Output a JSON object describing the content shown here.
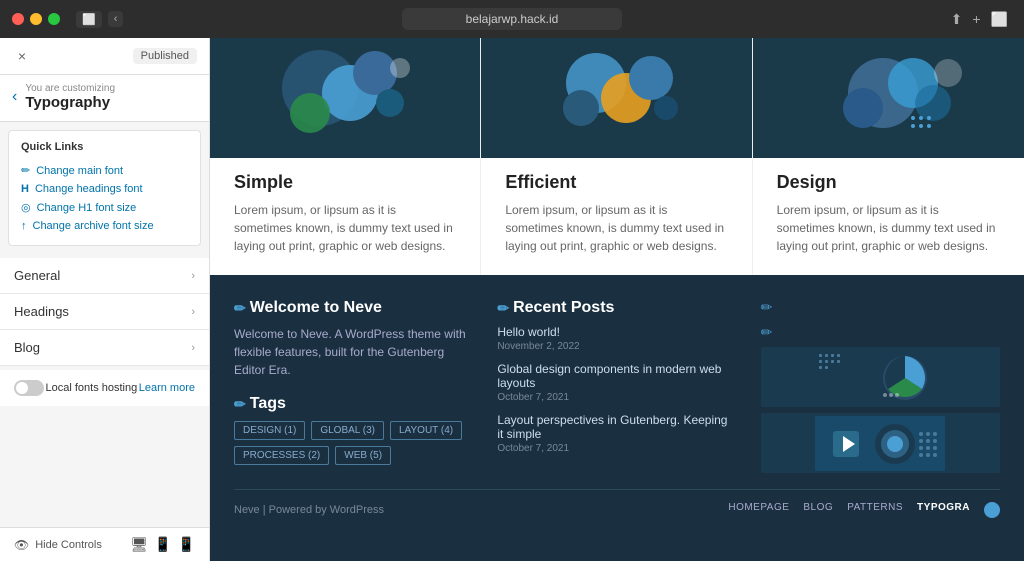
{
  "window": {
    "url": "belajarwp.hack.id",
    "title": "belajarwp.hack.id"
  },
  "customizer": {
    "close_label": "×",
    "published_label": "Published",
    "back_arrow": "‹",
    "customizing_label": "You are customizing",
    "section_title": "Typography",
    "quick_links": {
      "title": "Quick Links",
      "items": [
        {
          "icon": "✏",
          "label": "Change main font"
        },
        {
          "icon": "H",
          "label": "Change headings font"
        },
        {
          "icon": "◎",
          "label": "Change H1 font size"
        },
        {
          "icon": "↑",
          "label": "Change archive font size"
        }
      ]
    },
    "nav_items": [
      {
        "label": "General"
      },
      {
        "label": "Headings"
      },
      {
        "label": "Blog"
      }
    ],
    "local_fonts": {
      "label": "Local fonts hosting",
      "learn_more": "Learn more"
    },
    "footer": {
      "hide_controls": "Hide Controls"
    }
  },
  "features": [
    {
      "title": "Simple",
      "description": "Lorem ipsum, or lipsum as it is sometimes known, is dummy text used in laying out print, graphic or web designs."
    },
    {
      "title": "Efficient",
      "description": "Lorem ipsum, or lipsum as it is sometimes known, is dummy text used in laying out print, graphic or web designs."
    },
    {
      "title": "Design",
      "description": "Lorem ipsum, or lipsum as it is sometimes known, is dummy text used in laying out print, graphic or web designs."
    }
  ],
  "footer_widgets": {
    "welcome": {
      "title": "Welcome to Neve",
      "text": "Welcome to Neve. A WordPress theme with flexible features, built for the Gutenberg Editor Era."
    },
    "tags": {
      "title": "Tags",
      "items": [
        {
          "label": "DESIGN (1)"
        },
        {
          "label": "GLOBAL (3)"
        },
        {
          "label": "LAYOUT (4)"
        },
        {
          "label": "PROCESSES (2)"
        },
        {
          "label": "WEB (5)"
        }
      ]
    },
    "recent_posts": {
      "title": "Recent Posts",
      "posts": [
        {
          "title": "Hello world!",
          "date": "November 2, 2022"
        },
        {
          "title": "Global design components in modern web layouts",
          "date": "October 7, 2021"
        },
        {
          "title": "Layout perspectives in Gutenberg. Keeping it simple",
          "date": "October 7, 2021"
        }
      ]
    }
  },
  "footer_bottom": {
    "credit": "Neve | Powered by WordPress",
    "nav_items": [
      {
        "label": "HOMEPAGE"
      },
      {
        "label": "BLOG"
      },
      {
        "label": "PATTERNS"
      },
      {
        "label": "TYPOGRA",
        "active": true
      }
    ]
  }
}
